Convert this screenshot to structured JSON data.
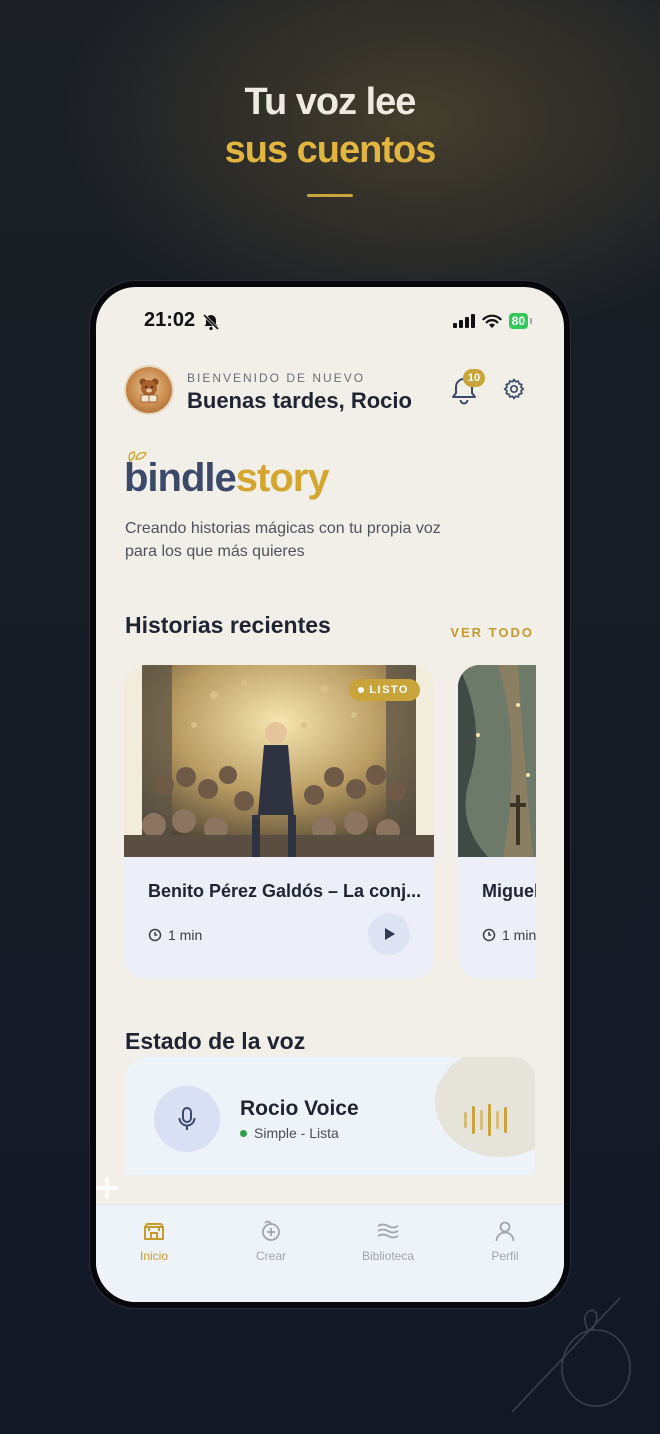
{
  "hero": {
    "line1": "Tu voz lee",
    "line2": "sus cuentos"
  },
  "status_bar": {
    "time": "21:02",
    "battery": "80"
  },
  "header": {
    "welcome": "BIENVENIDO DE NUEVO",
    "greeting": "Buenas tardes, Rocio",
    "notification_count": "10"
  },
  "brand": {
    "name_part1": "bindle",
    "name_part2": "story",
    "tagline": "Creando historias mágicas con tu propia voz para los que más quieres"
  },
  "recent": {
    "title": "Historias recientes",
    "see_all": "VER TODO",
    "stories": [
      {
        "title": "Benito Pérez Galdós – La conj...",
        "duration": "1 min",
        "badge": "LISTO"
      },
      {
        "title": "Miguel",
        "duration": "1 min"
      }
    ]
  },
  "voice": {
    "section_title": "Estado de la voz",
    "name": "Rocio Voice",
    "status": "Simple - Lista"
  },
  "tabs": [
    {
      "label": "Inicio",
      "icon": "home-icon",
      "active": true
    },
    {
      "label": "Crear",
      "icon": "create-icon",
      "active": false
    },
    {
      "label": "Biblioteca",
      "icon": "library-icon",
      "active": false
    },
    {
      "label": "Perfil",
      "icon": "profile-icon",
      "active": false
    }
  ],
  "colors": {
    "accent_gold": "#c9a43a",
    "brand_navy": "#3b4a6b",
    "screen_bg": "#f2efe9",
    "status_green": "#2e9d47"
  }
}
